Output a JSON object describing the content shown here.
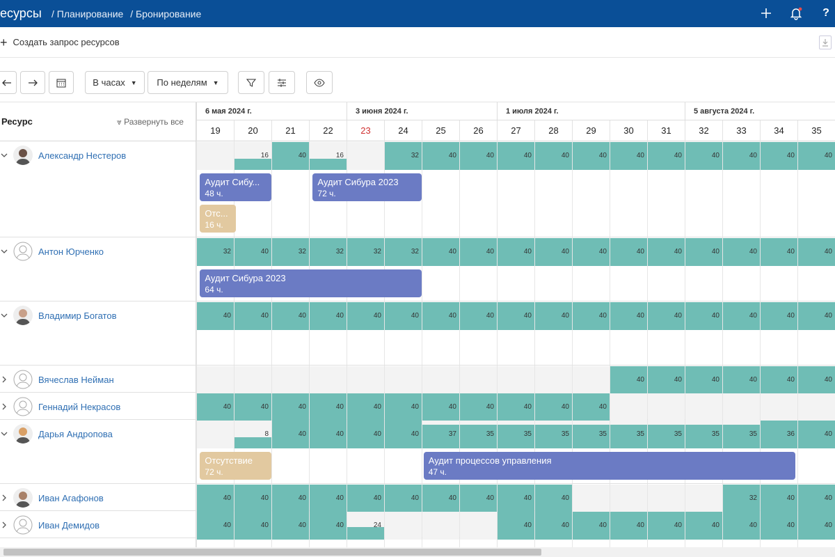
{
  "header": {
    "app": "есурсы",
    "crumbs": [
      "/ Планирование",
      "/ Бронирование"
    ]
  },
  "command": {
    "create_label": "Создать запрос ресурсов"
  },
  "toolbar": {
    "view_hours": "В часах",
    "view_weeks": "По неделям"
  },
  "left": {
    "title": "Ресурс",
    "expand_all": "Развернуть все"
  },
  "months": [
    {
      "label": "6 мая 2024 г."
    },
    {
      "label": "3 июня 2024 г."
    },
    {
      "label": "1 июля 2024 г."
    },
    {
      "label": "5 августа 2024 г."
    }
  ],
  "weeks": [
    "19",
    "20",
    "21",
    "22",
    "23",
    "24",
    "25",
    "26",
    "27",
    "28",
    "29",
    "30",
    "31",
    "32",
    "33",
    "34",
    "35"
  ],
  "resources": [
    {
      "name": "Александр Нестеров",
      "expanded": true
    },
    {
      "name": "Антон Юрченко",
      "expanded": true
    },
    {
      "name": "Владимир Богатов",
      "expanded": true
    },
    {
      "name": "Вячеслав Нейман",
      "expanded": false
    },
    {
      "name": "Геннадий Некрасов",
      "expanded": false
    },
    {
      "name": "Дарья Андропова",
      "expanded": true
    },
    {
      "name": "Иван Агафонов",
      "expanded": false
    },
    {
      "name": "Иван Демидов",
      "expanded": false
    }
  ],
  "capacity": [
    [
      "",
      "16",
      "40",
      "16",
      "",
      "32",
      "40",
      "40",
      "40",
      "40",
      "40",
      "40",
      "40",
      "40",
      "40",
      "40",
      "40"
    ],
    [
      "32",
      "40",
      "32",
      "32",
      "32",
      "32",
      "40",
      "40",
      "40",
      "40",
      "40",
      "40",
      "40",
      "40",
      "40",
      "40",
      "40"
    ],
    [
      "40",
      "40",
      "40",
      "40",
      "40",
      "40",
      "40",
      "40",
      "40",
      "40",
      "40",
      "40",
      "40",
      "40",
      "40",
      "40",
      "40"
    ],
    [
      "",
      "",
      "",
      "",
      "",
      "",
      "",
      "",
      "",
      "",
      "",
      "40",
      "40",
      "40",
      "40",
      "40",
      "40"
    ],
    [
      "40",
      "40",
      "40",
      "40",
      "40",
      "40",
      "40",
      "40",
      "40",
      "40",
      "40",
      "",
      "",
      "",
      "",
      "",
      ""
    ],
    [
      "",
      "8",
      "40",
      "40",
      "40",
      "40",
      "37",
      "35",
      "35",
      "35",
      "35",
      "35",
      "35",
      "35",
      "35",
      "36",
      "40"
    ],
    [
      "40",
      "40",
      "40",
      "40",
      "40",
      "40",
      "40",
      "40",
      "40",
      "40",
      "",
      "",
      "",
      "",
      "32",
      "40",
      "40"
    ],
    [
      "40",
      "40",
      "40",
      "40",
      "24",
      "",
      "",
      "",
      "40",
      "40",
      "40",
      "40",
      "40",
      "40",
      "40",
      "40",
      "40"
    ]
  ],
  "bookings": {
    "r0a": {
      "title": "Аудит Сибу...",
      "hours": "48 ч."
    },
    "r0b": {
      "title": "Аудит Сибура 2023",
      "hours": "72 ч."
    },
    "r0c": {
      "title": "Отс...",
      "hours": "16 ч."
    },
    "r1a": {
      "title": "Аудит Сибура 2023",
      "hours": "64 ч."
    },
    "r5a": {
      "title": "Отсутствие",
      "hours": "72 ч."
    },
    "r5b": {
      "title": "Аудит процессов управления",
      "hours": "47 ч."
    }
  },
  "colors": {
    "header": "#0a4f97",
    "capacity": "#6fbdb5",
    "booking": "#6b7bc4",
    "absence": "#e2c9a0"
  }
}
